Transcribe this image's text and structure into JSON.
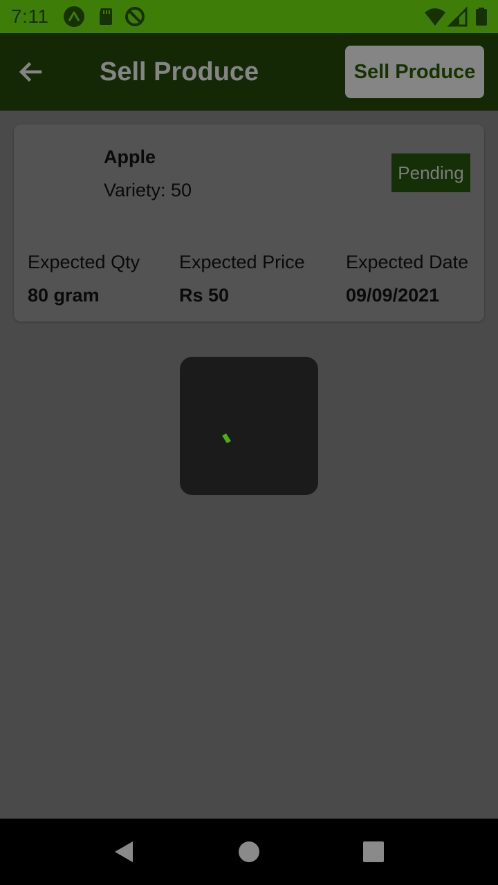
{
  "status_bar": {
    "time": "7:11",
    "icons": [
      "expo-icon",
      "sd-card-icon",
      "do-not-disturb-icon",
      "wifi-icon",
      "cellular-signal-icon",
      "battery-icon"
    ]
  },
  "app_bar": {
    "back_icon": "arrow-back-icon",
    "title": "Sell Produce",
    "action_label": "Sell Produce"
  },
  "card": {
    "name": "Apple",
    "variety": "Variety: 50",
    "status": "Pending",
    "details": [
      {
        "label": "Expected Qty",
        "value": "80 gram"
      },
      {
        "label": "Expected Price",
        "value": "Rs 50"
      },
      {
        "label": "Expected Date",
        "value": "09/09/2021"
      }
    ]
  },
  "loading": {
    "icon": "loading-spinner-icon"
  },
  "nav_bar": {
    "icons": [
      "nav-back-icon",
      "nav-home-icon",
      "nav-recents-icon"
    ]
  },
  "colors": {
    "status_bar": "#3d7d08",
    "app_bar": "#142806",
    "badge": "#153006",
    "accent_green": "#4caf1a",
    "overlay_background": "#4a4a4a"
  }
}
